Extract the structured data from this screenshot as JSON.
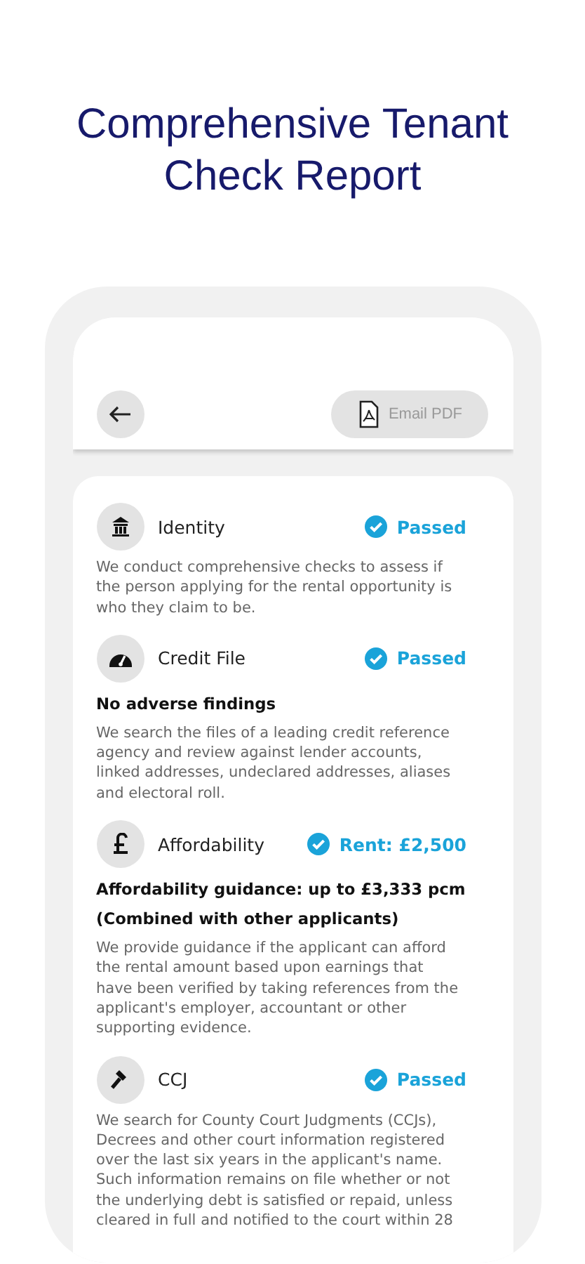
{
  "headline": "Comprehensive Tenant Check Report",
  "toolbar": {
    "email_button": "Email PDF"
  },
  "checks": [
    {
      "label": "Identity",
      "status": "Passed",
      "passed": true,
      "description": "We conduct comprehensive checks to assess if the person applying for the rental opportunity is who they claim to be."
    },
    {
      "label": "Credit File",
      "status": "Passed",
      "passed": true,
      "findings": [
        "No adverse findings"
      ],
      "description": "We search the files of a leading credit reference agency and review against lender accounts, linked addresses, undeclared addresses, aliases and electoral roll."
    },
    {
      "label": "Affordability",
      "status": "Rent: £2,500",
      "passed": true,
      "findings": [
        "Affordability guidance: up to £3,333 pcm",
        "(Combined with other applicants)"
      ],
      "description": "We provide guidance if the applicant can afford the rental amount based upon earnings that have been verified by taking references from the applicant's employer, accountant or other supporting evidence."
    },
    {
      "label": "CCJ",
      "status": "Passed",
      "passed": true,
      "description": "We search for County Court Judgments (CCJs), Decrees and other court information registered over the last six years in the applicant's name. Such information remains on file whether or not the underlying debt is satisfied or repaid, unless cleared in full and notified to the court within 28"
    }
  ]
}
